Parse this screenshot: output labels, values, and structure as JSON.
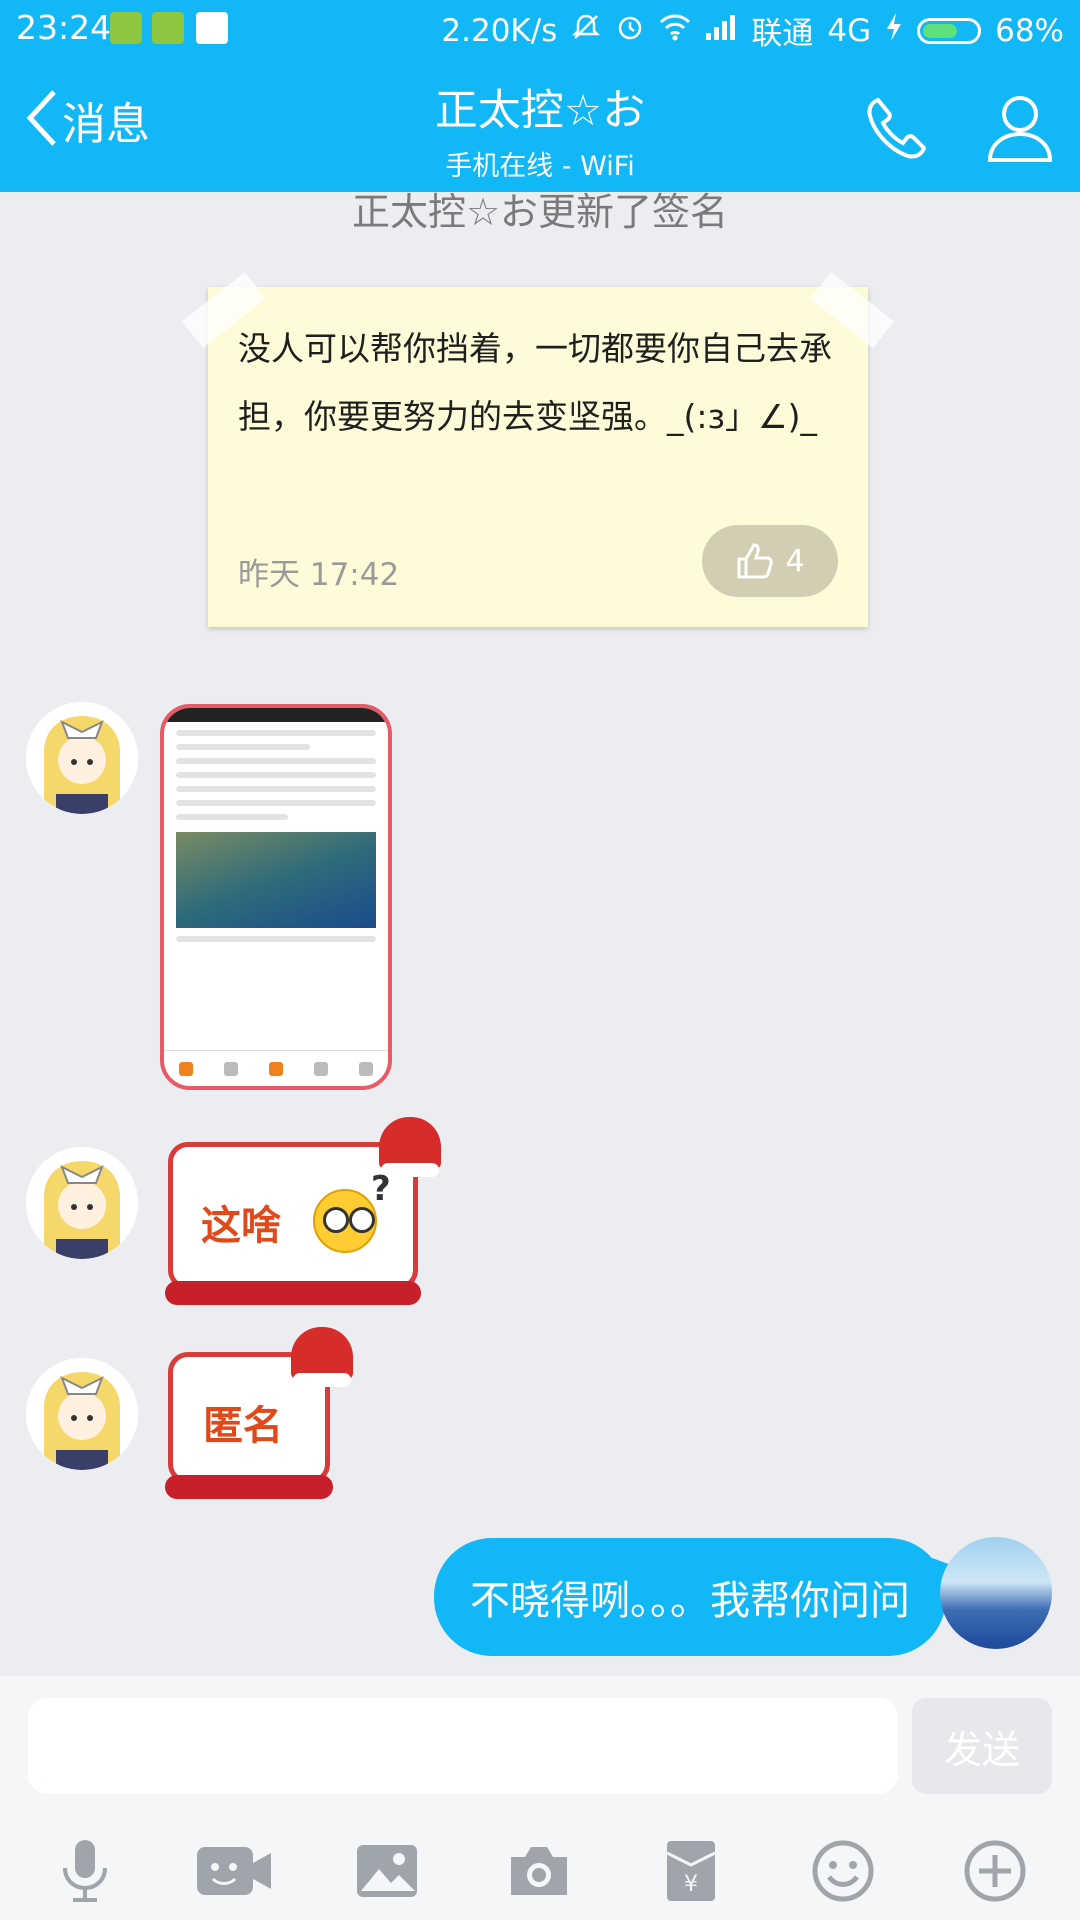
{
  "status_bar": {
    "time": "23:24",
    "net_speed": "2.20K/s",
    "carrier": "联通",
    "network": "4G",
    "battery": "68%",
    "battery_level": 0.68
  },
  "header": {
    "back_label": "消息",
    "contact_name": "正太控☆お",
    "contact_status": "手机在线 - WiFi",
    "icons": [
      "phone-icon",
      "profile-icon"
    ]
  },
  "chat": {
    "system_note": "正太控☆お更新了签名",
    "signature_card": {
      "text": "没人可以帮你挡着，一切都要你自己去承担，你要更努力的去变坚强。_(:з」∠)_",
      "time": "昨天 17:42",
      "likes": "4"
    },
    "stickers": [
      {
        "text": "这啥"
      },
      {
        "text": "匿名"
      }
    ],
    "my_message": "不晓得咧。。。我帮你问问"
  },
  "input": {
    "value": "",
    "placeholder": "",
    "send_label": "发送"
  },
  "toolbar": [
    "microphone-icon",
    "video-icon",
    "image-icon",
    "camera-icon",
    "red-packet-icon",
    "emoji-icon",
    "plus-icon"
  ],
  "colors": {
    "accent": "#12b7f5",
    "background": "#ecedf1",
    "sticky_note": "#fefbd8"
  }
}
